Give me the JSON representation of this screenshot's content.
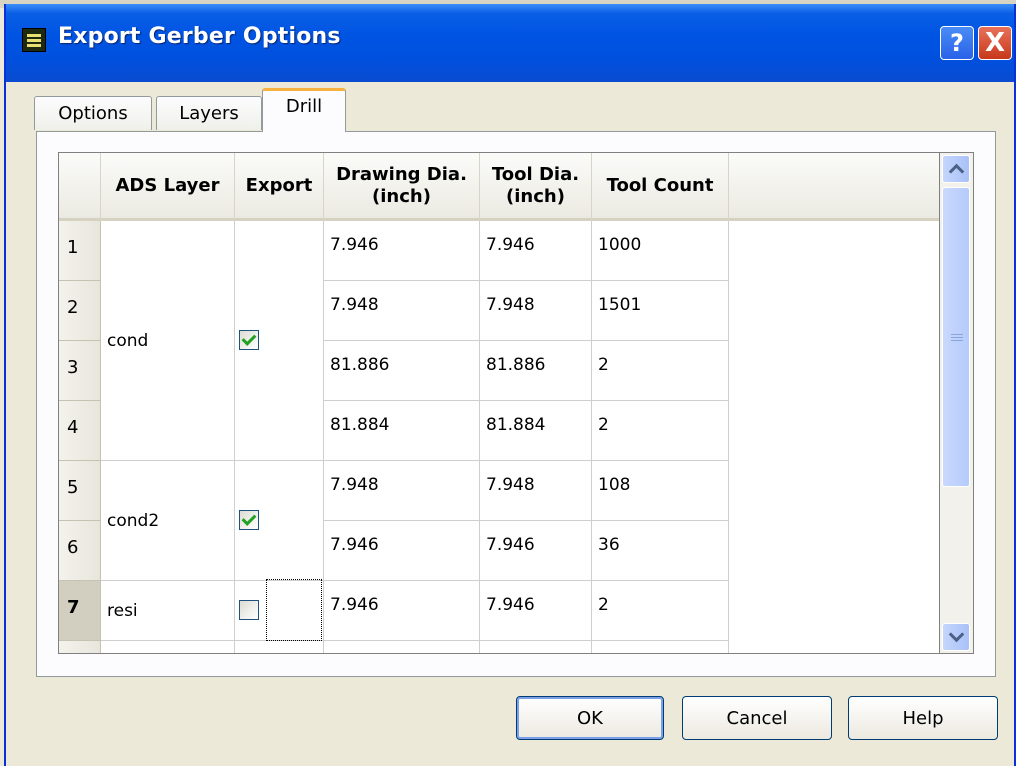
{
  "window": {
    "title": "Export Gerber Options",
    "help_label": "?",
    "close_label": "X"
  },
  "tabs": [
    {
      "label": "Options",
      "active": false
    },
    {
      "label": "Layers",
      "active": false
    },
    {
      "label": "Drill",
      "active": true
    }
  ],
  "table": {
    "columns": [
      "ADS Layer",
      "Export",
      "Drawing Dia.\n(inch)",
      "Tool Dia.\n(inch)",
      "Tool Count"
    ],
    "groups": [
      {
        "layer": "cond",
        "export": true
      },
      {
        "layer": "cond2",
        "export": true
      },
      {
        "layer": "resi",
        "export": false
      }
    ],
    "rows": [
      {
        "n": "1",
        "drawing_dia": "7.946",
        "tool_dia": "7.946",
        "tool_count": "1000"
      },
      {
        "n": "2",
        "drawing_dia": "7.948",
        "tool_dia": "7.948",
        "tool_count": "1501"
      },
      {
        "n": "3",
        "drawing_dia": "81.886",
        "tool_dia": "81.886",
        "tool_count": "2"
      },
      {
        "n": "4",
        "drawing_dia": "81.884",
        "tool_dia": "81.884",
        "tool_count": "2"
      },
      {
        "n": "5",
        "drawing_dia": "7.948",
        "tool_dia": "7.948",
        "tool_count": "108"
      },
      {
        "n": "6",
        "drawing_dia": "7.946",
        "tool_dia": "7.946",
        "tool_count": "36"
      },
      {
        "n": "7",
        "drawing_dia": "7.946",
        "tool_dia": "7.946",
        "tool_count": "2"
      }
    ],
    "current_row": "7"
  },
  "buttons": {
    "ok": "OK",
    "cancel": "Cancel",
    "help": "Help"
  },
  "colors": {
    "titlebar": "#0054e3",
    "tab_highlight": "#f6b140",
    "check": "#21a121"
  }
}
